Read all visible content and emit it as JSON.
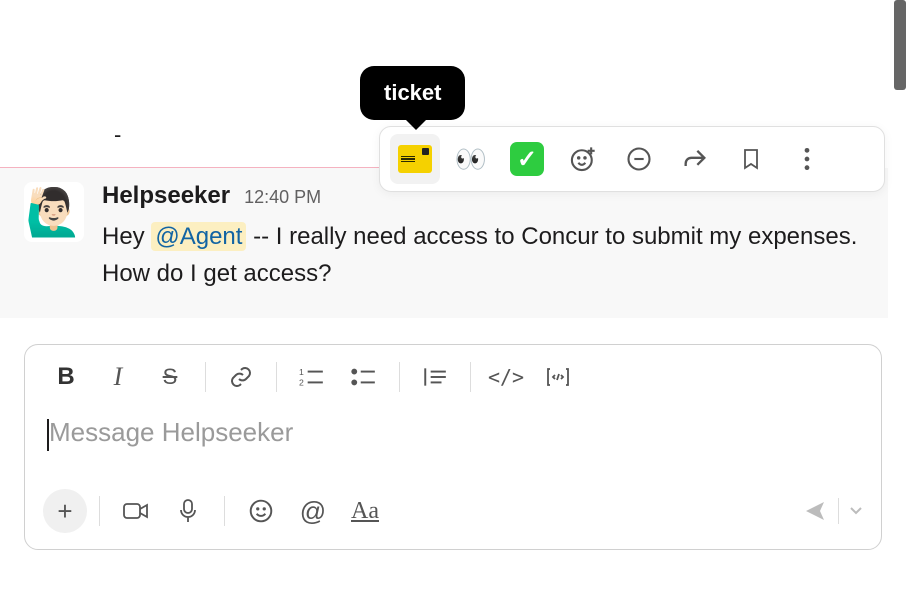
{
  "tooltip": {
    "label": "ticket"
  },
  "stray_text": "-",
  "message": {
    "avatar_emoji": "🙋🏻‍♂️",
    "user": "Helpseeker",
    "time": "12:40 PM",
    "text_pre": "Hey ",
    "mention": "@Agent",
    "text_post": " -- I really need access to Concur to submit my expenses. How do I get access?"
  },
  "action_bar": {
    "ticket": "ticket",
    "eyes": "👀",
    "check": "✓",
    "add_reaction": "add-reaction",
    "thread": "thread",
    "share": "share",
    "bookmark": "bookmark",
    "more": "more"
  },
  "composer": {
    "placeholder": "Message Helpseeker",
    "format": {
      "bold": "B",
      "italic": "I",
      "strike": "S",
      "link": "link",
      "ordered": "ol",
      "bullet": "ul",
      "quote": "quote",
      "code": "</>",
      "codeblock": "codeblock"
    },
    "bottom": {
      "plus": "+",
      "video": "video",
      "mic": "mic",
      "emoji": "emoji",
      "mention": "@",
      "format_toggle": "Aa",
      "send": "send"
    }
  }
}
